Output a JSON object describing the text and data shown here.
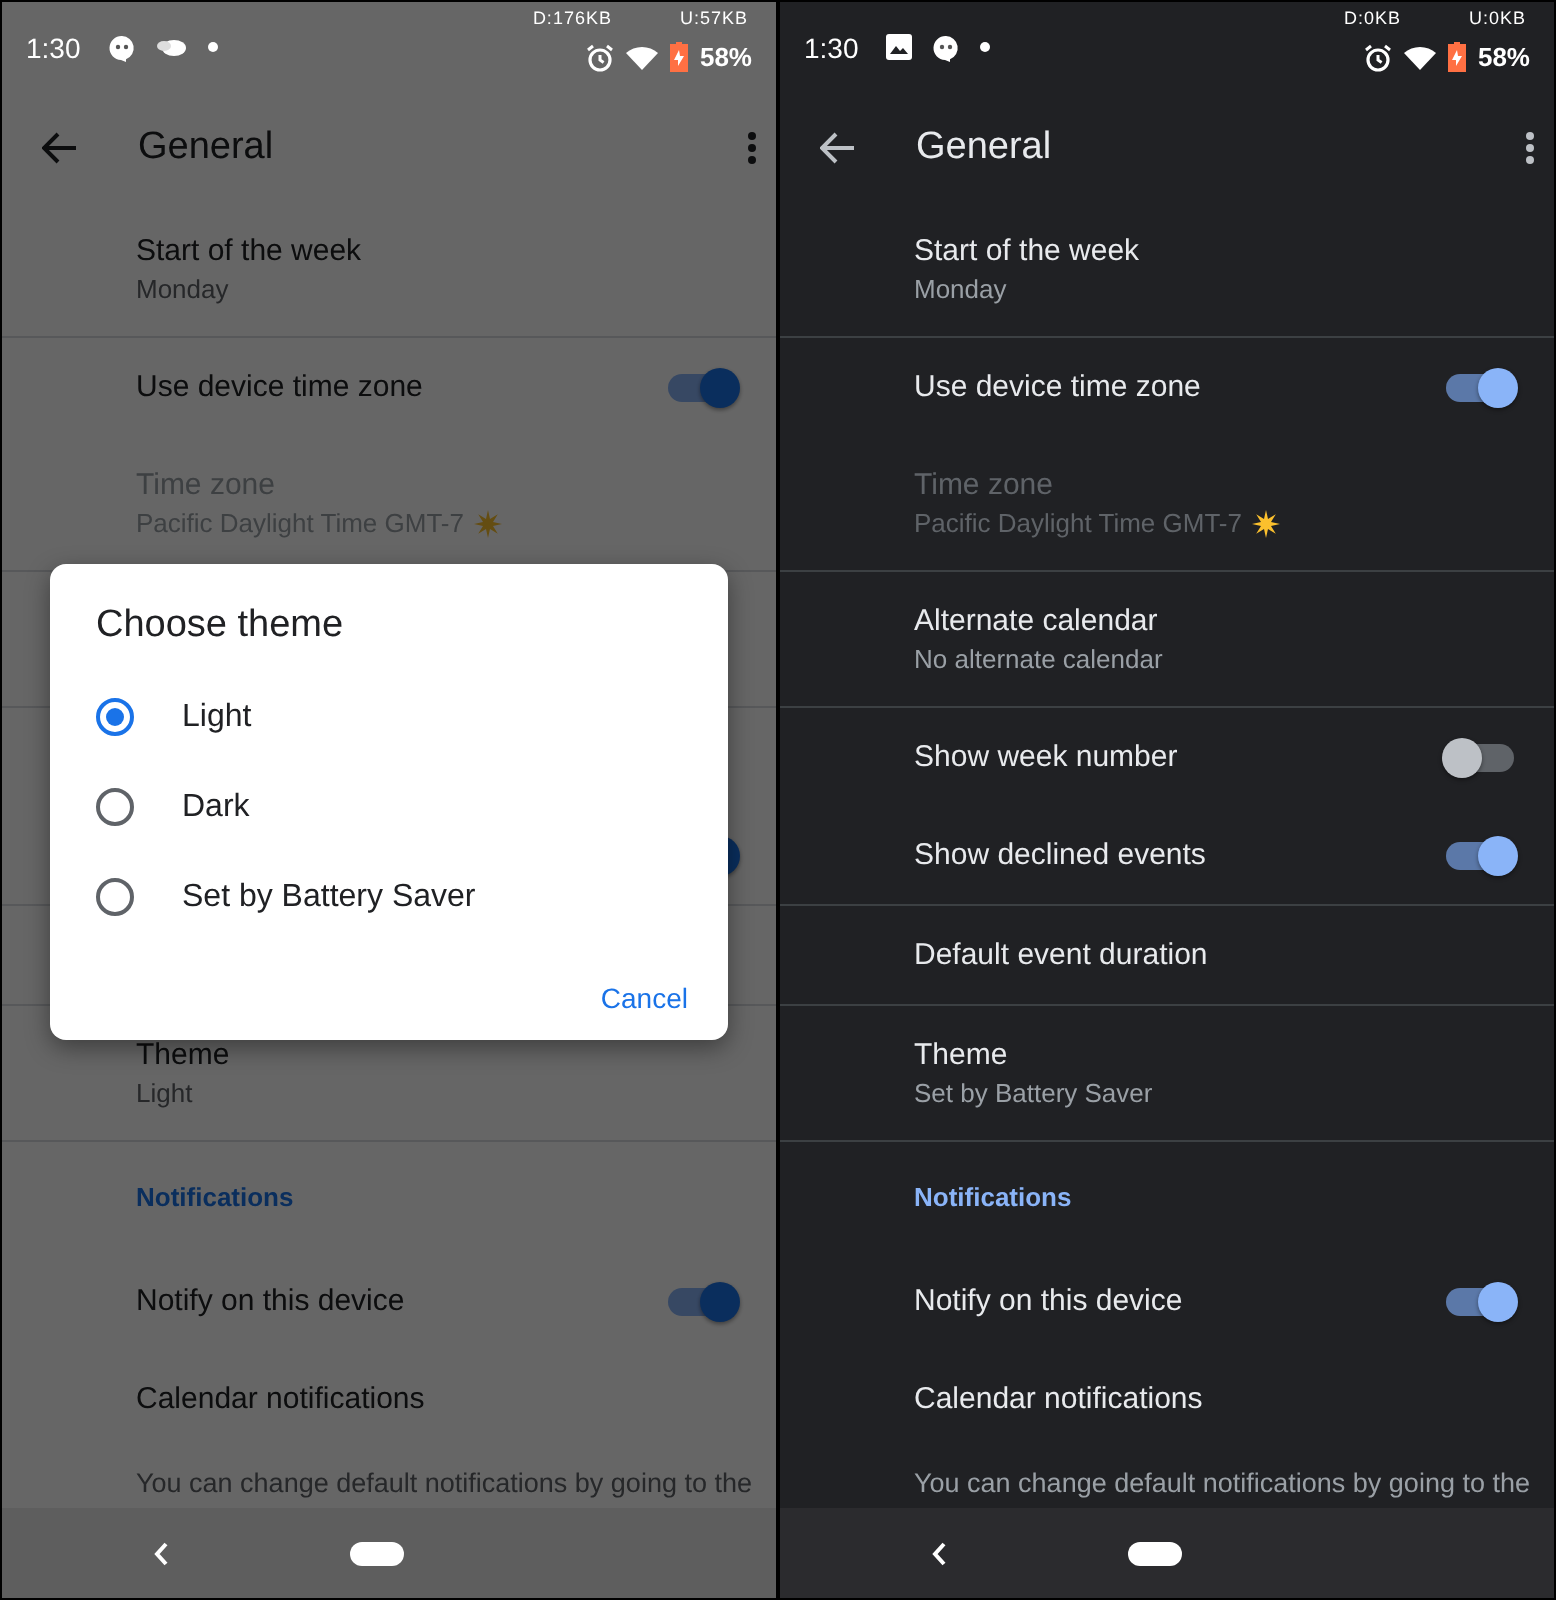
{
  "screens": [
    {
      "dark": false,
      "dimmed": true,
      "status_bar": {
        "time": "1:30",
        "notifications": [
          {
            "kind": "chat"
          },
          {
            "kind": "cloud"
          }
        ],
        "download": "D:176KB",
        "upload": "U:57KB",
        "battery": "58%"
      },
      "toolbar": {
        "title": "General"
      },
      "settings": [
        {
          "kind": "two-line",
          "title": "Start of the week",
          "subtitle": "Monday"
        },
        {
          "kind": "divider"
        },
        {
          "kind": "toggle",
          "title": "Use device time zone",
          "on": true
        },
        {
          "kind": "timezone",
          "title": "Time zone",
          "subtitle": "Pacific Daylight Time  GMT-7"
        },
        {
          "kind": "divider"
        },
        {
          "kind": "covered-tall"
        },
        {
          "kind": "divider"
        },
        {
          "kind": "covered"
        },
        {
          "kind": "covered-toggle",
          "on": true
        },
        {
          "kind": "divider"
        },
        {
          "kind": "covered"
        },
        {
          "kind": "divider"
        },
        {
          "kind": "two-line",
          "title": "Theme",
          "subtitle": "Light"
        },
        {
          "kind": "divider"
        },
        {
          "kind": "header",
          "title": "Notifications"
        },
        {
          "kind": "toggle",
          "title": "Notify on this device",
          "on": true
        },
        {
          "kind": "single",
          "title": "Calendar notifications"
        },
        {
          "kind": "footer",
          "title": "You can change default notifications by going to the"
        }
      ],
      "dialog": {
        "title": "Choose theme",
        "options": [
          {
            "label": "Light",
            "selected": true
          },
          {
            "label": "Dark",
            "selected": false
          },
          {
            "label": "Set by Battery Saver",
            "selected": false
          }
        ],
        "button": "Cancel"
      }
    },
    {
      "dark": true,
      "dimmed": false,
      "status_bar": {
        "time": "1:30",
        "notifications": [
          {
            "kind": "image"
          },
          {
            "kind": "chat"
          }
        ],
        "download": "D:0KB",
        "upload": "U:0KB",
        "battery": "58%"
      },
      "toolbar": {
        "title": "General"
      },
      "settings": [
        {
          "kind": "two-line",
          "title": "Start of the week",
          "subtitle": "Monday"
        },
        {
          "kind": "divider"
        },
        {
          "kind": "toggle",
          "title": "Use device time zone",
          "on": true
        },
        {
          "kind": "timezone",
          "title": "Time zone",
          "subtitle": "Pacific Daylight Time  GMT-7"
        },
        {
          "kind": "divider"
        },
        {
          "kind": "two-line",
          "title": "Alternate calendar",
          "subtitle": "No alternate calendar"
        },
        {
          "kind": "divider"
        },
        {
          "kind": "toggle",
          "title": "Show week number",
          "on": false
        },
        {
          "kind": "toggle",
          "title": "Show declined events",
          "on": true
        },
        {
          "kind": "divider"
        },
        {
          "kind": "single",
          "title": "Default event duration"
        },
        {
          "kind": "divider"
        },
        {
          "kind": "two-line",
          "title": "Theme",
          "subtitle": "Set by Battery Saver"
        },
        {
          "kind": "divider"
        },
        {
          "kind": "header",
          "title": "Notifications"
        },
        {
          "kind": "toggle",
          "title": "Notify on this device",
          "on": true
        },
        {
          "kind": "single",
          "title": "Calendar notifications"
        },
        {
          "kind": "footer",
          "title": "You can change default notifications by going to the"
        }
      ]
    }
  ]
}
